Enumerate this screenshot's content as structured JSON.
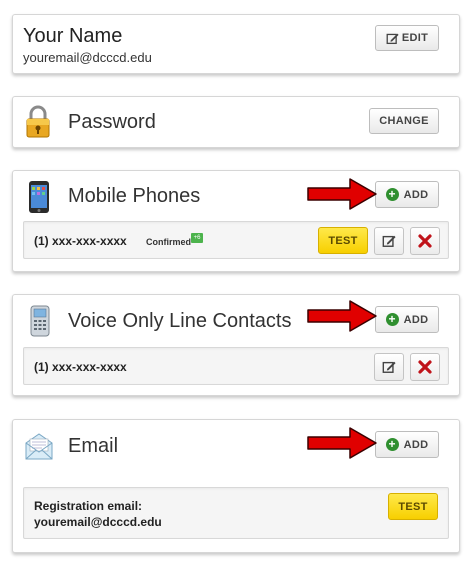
{
  "profile": {
    "name": "Your Name",
    "email": "youremail@dcccd.edu",
    "edit_label": "EDIT"
  },
  "password": {
    "title": "Password",
    "change_label": "CHANGE"
  },
  "mobile": {
    "title": "Mobile Phones",
    "add_label": "ADD",
    "number": "(1) xxx-xxx-xxxx",
    "status": "Confirmed",
    "badge": "+6",
    "test_label": "TEST"
  },
  "voice": {
    "title": "Voice Only Line Contacts",
    "add_label": "ADD",
    "number": "(1) xxx-xxx-xxxx"
  },
  "email": {
    "title": "Email",
    "add_label": "ADD",
    "reg_label": "Registration email:",
    "reg_value": "youremail@dcccd.edu",
    "test_label": "TEST"
  },
  "colors": {
    "arrow": "#e00000",
    "test_button": "#f7d400",
    "add_plus": "#2f8f2f",
    "delete_x": "#c0131a"
  }
}
